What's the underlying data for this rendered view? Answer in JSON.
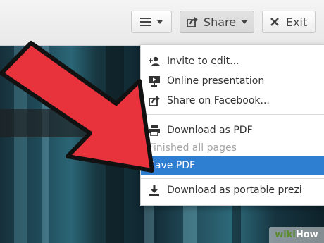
{
  "toolbar": {
    "menu_button": {
      "icon": "hamburger-icon"
    },
    "share_button": {
      "label": "Share",
      "icon": "share-icon"
    },
    "exit_button": {
      "label": "Exit",
      "icon": "close-icon"
    }
  },
  "share_menu": {
    "items": [
      {
        "label": "Invite to edit...",
        "icon": "add-person-icon",
        "state": "normal"
      },
      {
        "label": "Online presentation",
        "icon": "presentation-icon",
        "state": "normal"
      },
      {
        "label": "Share on Facebook...",
        "icon": "share-icon",
        "state": "normal"
      },
      {
        "label": "Download as PDF",
        "icon": "printer-icon",
        "state": "normal"
      },
      {
        "label": "Finished all pages",
        "icon": "",
        "state": "disabled"
      },
      {
        "label": "Save PDF",
        "icon": "",
        "state": "highlighted"
      },
      {
        "label": "Download as portable prezi",
        "icon": "download-icon",
        "state": "normal"
      }
    ]
  },
  "annotation": {
    "shape": "arrow",
    "color": "#e8323c"
  },
  "watermark": {
    "part1": "wiki",
    "part2": "How"
  },
  "colors": {
    "highlight": "#2e7ed2",
    "arrow": "#e8323c"
  }
}
